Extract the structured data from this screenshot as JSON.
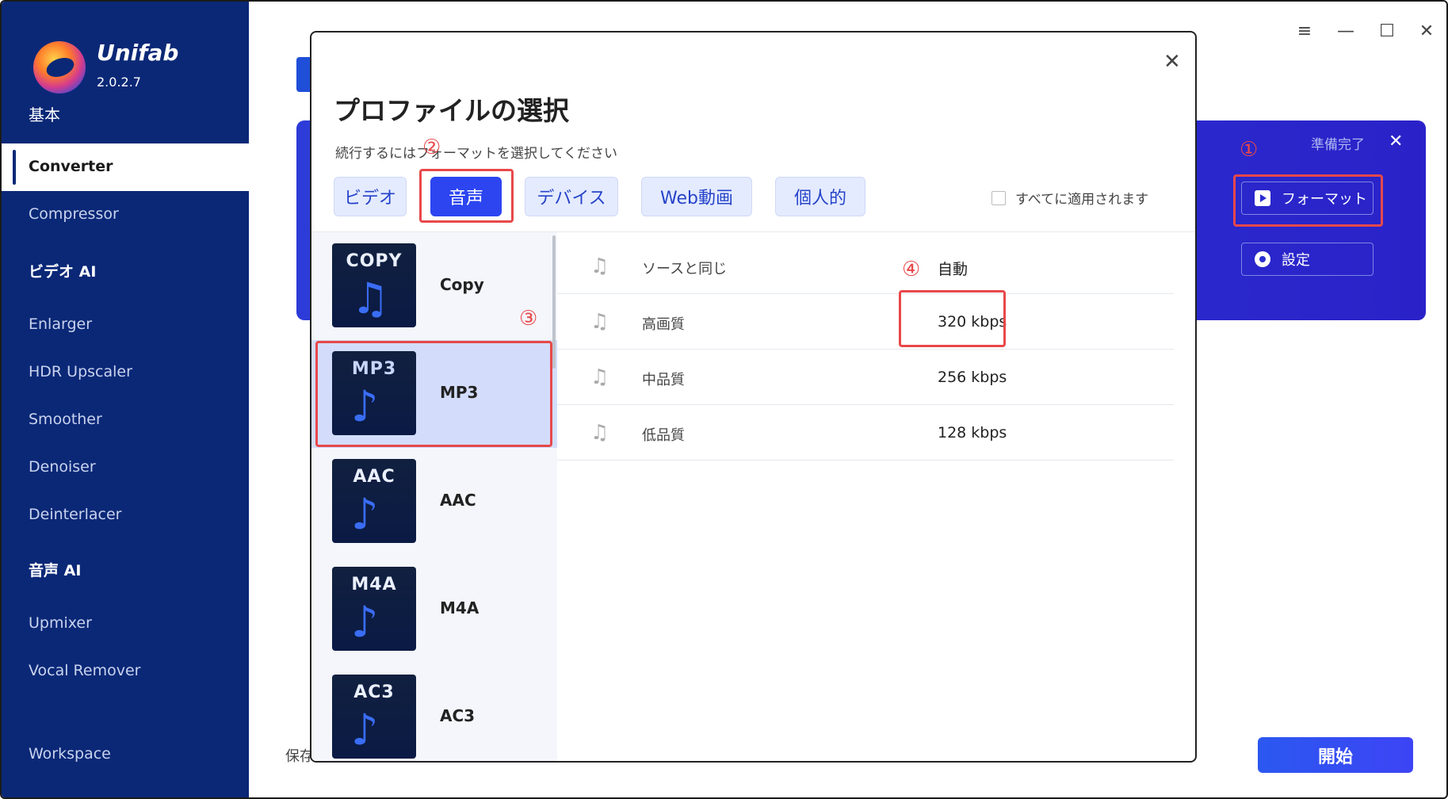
{
  "app": {
    "name": "Unifab",
    "version": "2.0.2.7"
  },
  "sidebar": {
    "basic": "基本",
    "active_item": "Converter",
    "items_basic": [
      "Compressor"
    ],
    "video_ai_title": "ビデオ AI",
    "video_ai_items": [
      "Enlarger",
      "HDR Upscaler",
      "Smoother",
      "Denoiser",
      "Deinterlacer"
    ],
    "audio_ai_title": "音声 AI",
    "audio_ai_items": [
      "Upmixer",
      "Vocal Remover"
    ],
    "workspace": "Workspace"
  },
  "window_controls": {
    "menu": "≡",
    "minimize": "—",
    "maximize": "☐",
    "close": "✕"
  },
  "task_card": {
    "status": "準備完了",
    "close": "✕",
    "format_button": "フォーマット",
    "settings_button": "設定"
  },
  "footer": {
    "save_label": "保存",
    "start_button": "開始"
  },
  "annotations": {
    "n1": "①",
    "n2": "②",
    "n3": "③",
    "n4": "④",
    "color": "#e8484a"
  },
  "modal": {
    "close": "✕",
    "title": "プロファイルの選択",
    "subtitle": "続行するにはフォーマットを選択してください",
    "tabs": [
      "ビデオ",
      "音声",
      "デバイス",
      "Web動画",
      "個人的"
    ],
    "active_tab": "音声",
    "apply_all": "すべてに適用されます",
    "formats": [
      {
        "tag": "COPY",
        "name": "Copy"
      },
      {
        "tag": "MP3",
        "name": "MP3",
        "selected": true
      },
      {
        "tag": "AAC",
        "name": "AAC"
      },
      {
        "tag": "M4A",
        "name": "M4A"
      },
      {
        "tag": "AC3",
        "name": "AC3"
      }
    ],
    "qualities": [
      {
        "name": "ソースと同じ",
        "value": "自動"
      },
      {
        "name": "高画質",
        "value": "320 kbps",
        "highlighted": true
      },
      {
        "name": "中品質",
        "value": "256 kbps"
      },
      {
        "name": "低品質",
        "value": "128 kbps"
      }
    ]
  },
  "colors": {
    "sidebar": "#0b2877",
    "accent": "#2c45f0",
    "card": "#2a2ed0"
  }
}
